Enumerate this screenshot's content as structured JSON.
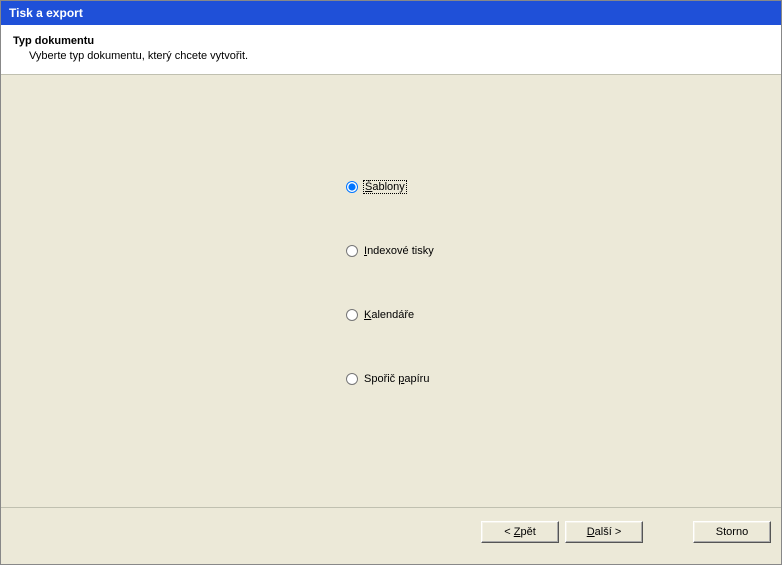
{
  "titlebar": {
    "title": "Tisk a export"
  },
  "header": {
    "title": "Typ dokumentu",
    "description": "Vyberte typ dokumentu, který chcete vytvořit."
  },
  "options": {
    "templates": {
      "prefix": "Š",
      "rest": "ablony",
      "selected": true
    },
    "index": {
      "prefix": "I",
      "rest": "ndexové tisky",
      "selected": false
    },
    "calendars": {
      "prefix": "K",
      "rest": "alendáře",
      "selected": false
    },
    "paper": {
      "text1": "Spořič ",
      "prefix": "p",
      "rest": "apíru",
      "selected": false
    }
  },
  "buttons": {
    "back_prefix": "< ",
    "back_u": "Z",
    "back_rest": "pět",
    "next_u": "D",
    "next_rest": "alší >",
    "cancel": "Storno"
  }
}
